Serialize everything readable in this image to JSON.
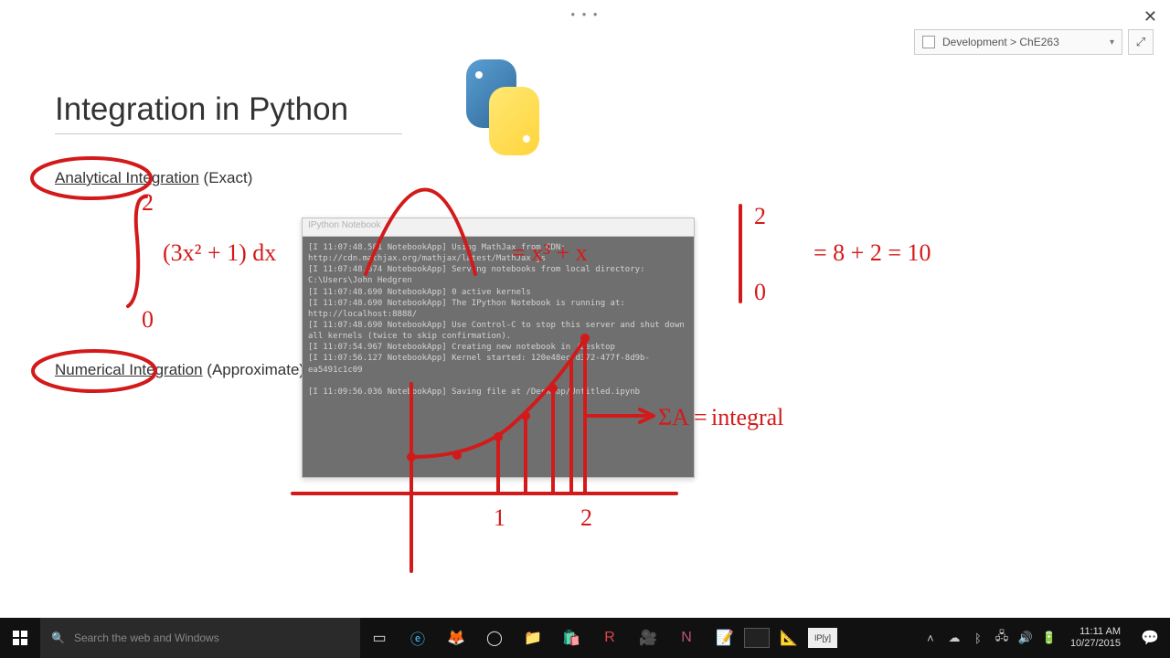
{
  "header": {
    "breadcrumb": "Development > ChE263"
  },
  "page": {
    "title": "Integration in Python",
    "section1_underlined": "Analytical Integration",
    "section1_rest": " (Exact)",
    "section2_underlined": "Numerical Integration",
    "section2_rest": " (Approximate)"
  },
  "terminal": {
    "title": "IPython Notebook",
    "lines": "[I 11:07:48.581 NotebookApp] Using MathJax from CDN: http://cdn.mathjax.org/mathjax/latest/MathJax.js\n[I 11:07:48.674 NotebookApp] Serving notebooks from local directory: C:\\Users\\John Hedgren\n[I 11:07:48.690 NotebookApp] 0 active kernels\n[I 11:07:48.690 NotebookApp] The IPython Notebook is running at: http://localhost:8888/\n[I 11:07:48.690 NotebookApp] Use Control-C to stop this server and shut down all kernels (twice to skip confirmation).\n[I 11:07:54.967 NotebookApp] Creating new notebook in /Desktop\n[I 11:07:56.127 NotebookApp] Kernel started: 120e48ec-d372-477f-8d9b-ea5491c1c09\n\n[I 11:09:56.036 NotebookApp] Saving file at /Desktop/Untitled.ipynb"
  },
  "ink": {
    "integral_expr": "(3x² + 1) dx",
    "limit_lower": "0",
    "limit_upper": "2",
    "antiderivative_mid": "= x³ + x",
    "result": "=  8 + 2 = 10",
    "graph_label_1": "1",
    "graph_label_2": "2",
    "sum_label": "ΣA =",
    "integral_word": "integral"
  },
  "taskbar": {
    "search_placeholder": "Search the web and Windows",
    "time": "11:11 AM",
    "date": "10/27/2015"
  }
}
